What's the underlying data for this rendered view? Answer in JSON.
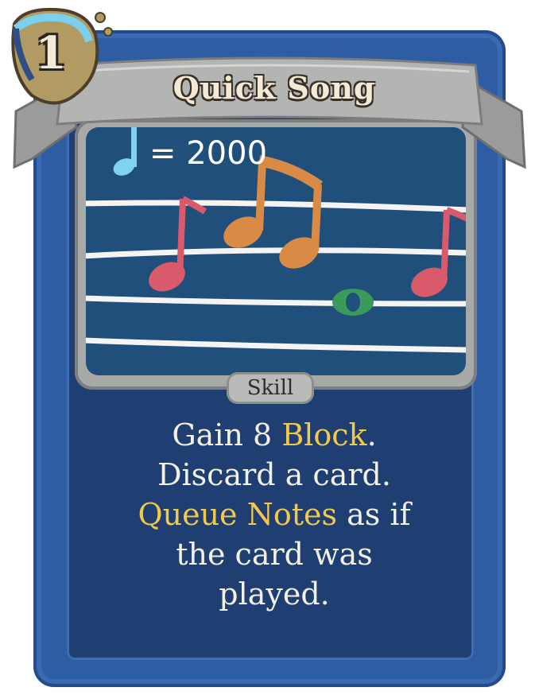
{
  "card": {
    "cost": "1",
    "title": "Quick Song",
    "type": "Skill",
    "description": {
      "line1_pre": "Gain 8 ",
      "line1_kw": "Block",
      "line1_post": ".",
      "line2": "Discard a card.",
      "line3_kw": "Queue Notes",
      "line3_post": " as if",
      "line4": "the card was",
      "line5": "played."
    },
    "art": {
      "tempo_text": "= 2000",
      "icons": [
        "quarter-note-icon",
        "eighth-note-icon",
        "beamed-notes-icon",
        "whole-note-icon"
      ]
    },
    "colors": {
      "frame": "#2f5da3",
      "keyword": "#f2c94c",
      "note_red": "#d95a6b",
      "note_orange": "#d98b45",
      "note_green": "#3a9a5c",
      "note_cyan": "#7fd3ee"
    }
  }
}
